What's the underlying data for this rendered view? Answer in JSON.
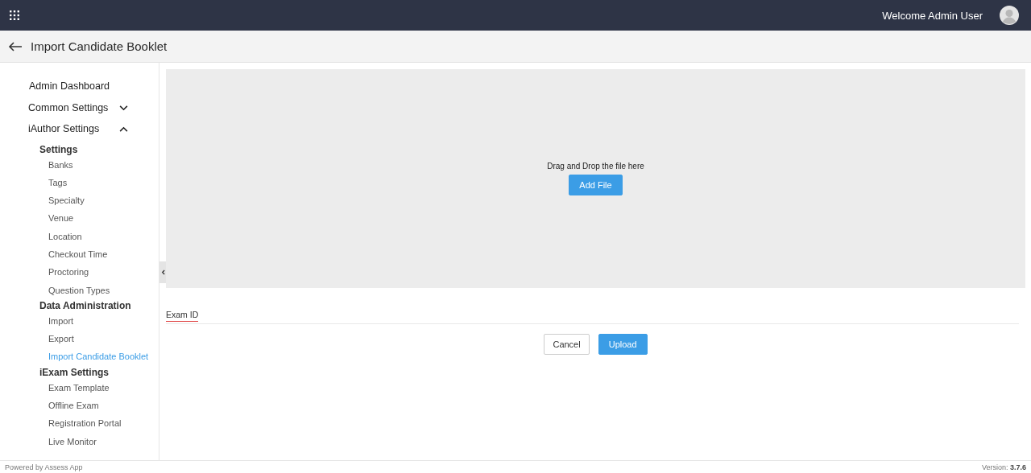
{
  "topbar": {
    "welcome": "Welcome Admin User"
  },
  "page_header": {
    "title": "Import Candidate Booklet"
  },
  "sidebar": {
    "items": [
      {
        "label": "Admin Dashboard",
        "kind": "top"
      },
      {
        "label": "Common Settings",
        "kind": "group",
        "expanded": false
      },
      {
        "label": "iAuthor Settings",
        "kind": "group",
        "expanded": true,
        "children": [
          {
            "label": "Settings",
            "kind": "heading",
            "children": [
              {
                "label": "Banks",
                "kind": "link",
                "selected": false
              },
              {
                "label": "Tags",
                "kind": "link",
                "selected": false
              },
              {
                "label": "Specialty",
                "kind": "link",
                "selected": false
              },
              {
                "label": "Venue",
                "kind": "link",
                "selected": false
              },
              {
                "label": "Location",
                "kind": "link",
                "selected": false
              },
              {
                "label": "Checkout Time",
                "kind": "link",
                "selected": false
              },
              {
                "label": "Proctoring",
                "kind": "link",
                "selected": false
              },
              {
                "label": "Question Types",
                "kind": "link",
                "selected": false
              }
            ]
          },
          {
            "label": "Data Administration",
            "kind": "heading",
            "children": [
              {
                "label": "Import",
                "kind": "link",
                "selected": false
              },
              {
                "label": "Export",
                "kind": "link",
                "selected": false
              },
              {
                "label": "Import Candidate Booklet",
                "kind": "link",
                "selected": true
              }
            ]
          },
          {
            "label": "iExam Settings",
            "kind": "heading",
            "children": [
              {
                "label": "Exam Template",
                "kind": "link",
                "selected": false
              },
              {
                "label": "Offline Exam",
                "kind": "link",
                "selected": false
              },
              {
                "label": "Registration Portal",
                "kind": "link",
                "selected": false
              },
              {
                "label": "Live Monitor",
                "kind": "link",
                "selected": false
              }
            ]
          }
        ]
      }
    ]
  },
  "dropzone": {
    "text": "Drag and Drop the file here",
    "button": "Add File"
  },
  "exam_id": {
    "label": "Exam ID"
  },
  "buttons": [
    {
      "label": "Cancel",
      "kind": "secondary"
    },
    {
      "label": "Upload",
      "kind": "primary"
    }
  ],
  "footer": {
    "powered": "Powered by Assess App",
    "version": "Version: **3.7.6**"
  }
}
